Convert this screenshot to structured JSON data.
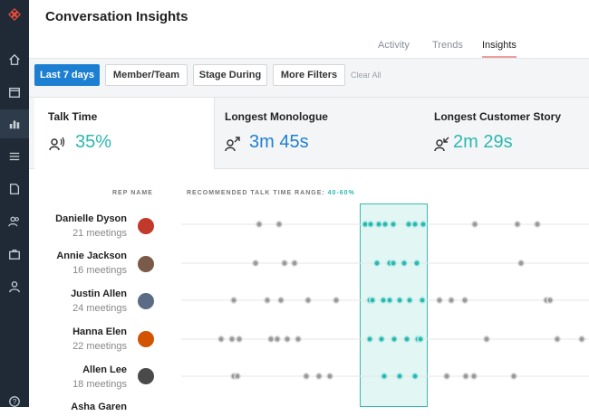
{
  "app": {
    "title": "Conversation Insights"
  },
  "tabs": [
    {
      "label": "Activity",
      "active": false
    },
    {
      "label": "Trends",
      "active": false
    },
    {
      "label": "Insights",
      "active": true
    }
  ],
  "sidebar": {
    "icons": [
      "logo-icon",
      "home-icon",
      "calendar-icon",
      "bar-chart-icon",
      "list-icon",
      "document-icon",
      "users-icon",
      "briefcase-icon",
      "user-icon",
      "help-icon"
    ],
    "active": "bar-chart-icon",
    "background": "#1f2a36"
  },
  "filters": {
    "buttons": [
      "Last 7 days",
      "Member/Team",
      "Stage During",
      "More Filters"
    ],
    "clear_label": "Clear All"
  },
  "metrics": [
    {
      "label": "Talk Time",
      "value": "35%",
      "icon": "talk-icon",
      "color": "#2bb8b0"
    },
    {
      "label": "Longest Monologue",
      "value": "3m 45s",
      "icon": "arrow-out-icon",
      "color": "#1d7fd1"
    },
    {
      "label": "Longest Customer Story",
      "value": "2m 29s",
      "icon": "arrow-in-icon",
      "color": "#2bb8b0"
    }
  ],
  "table": {
    "rep_header": "REP NAME",
    "range_header": "RECOMMENDED TALK TIME RANGE:",
    "range_value": "40-60%",
    "reps": [
      {
        "name": "Danielle Dyson",
        "meetings": "21 meetings",
        "avatar_color": "#c0392b"
      },
      {
        "name": "Annie Jackson",
        "meetings": "16 meetings",
        "avatar_color": "#7a5a48"
      },
      {
        "name": "Justin Allen",
        "meetings": "24 meetings",
        "avatar_color": "#5a6b85"
      },
      {
        "name": "Hanna Elen",
        "meetings": "22 meetings",
        "avatar_color": "#d35400"
      },
      {
        "name": "Allen  Lee",
        "meetings": "18 meetings",
        "avatar_color": "#4a4a4a"
      },
      {
        "name": "Asha  Garen",
        "meetings": "",
        "avatar_color": "#888888"
      }
    ]
  },
  "colors": {
    "accent_teal": "#2bb8b0",
    "primary_blue": "#1d7fd1",
    "dot_gray": "#9a9a9a"
  }
}
